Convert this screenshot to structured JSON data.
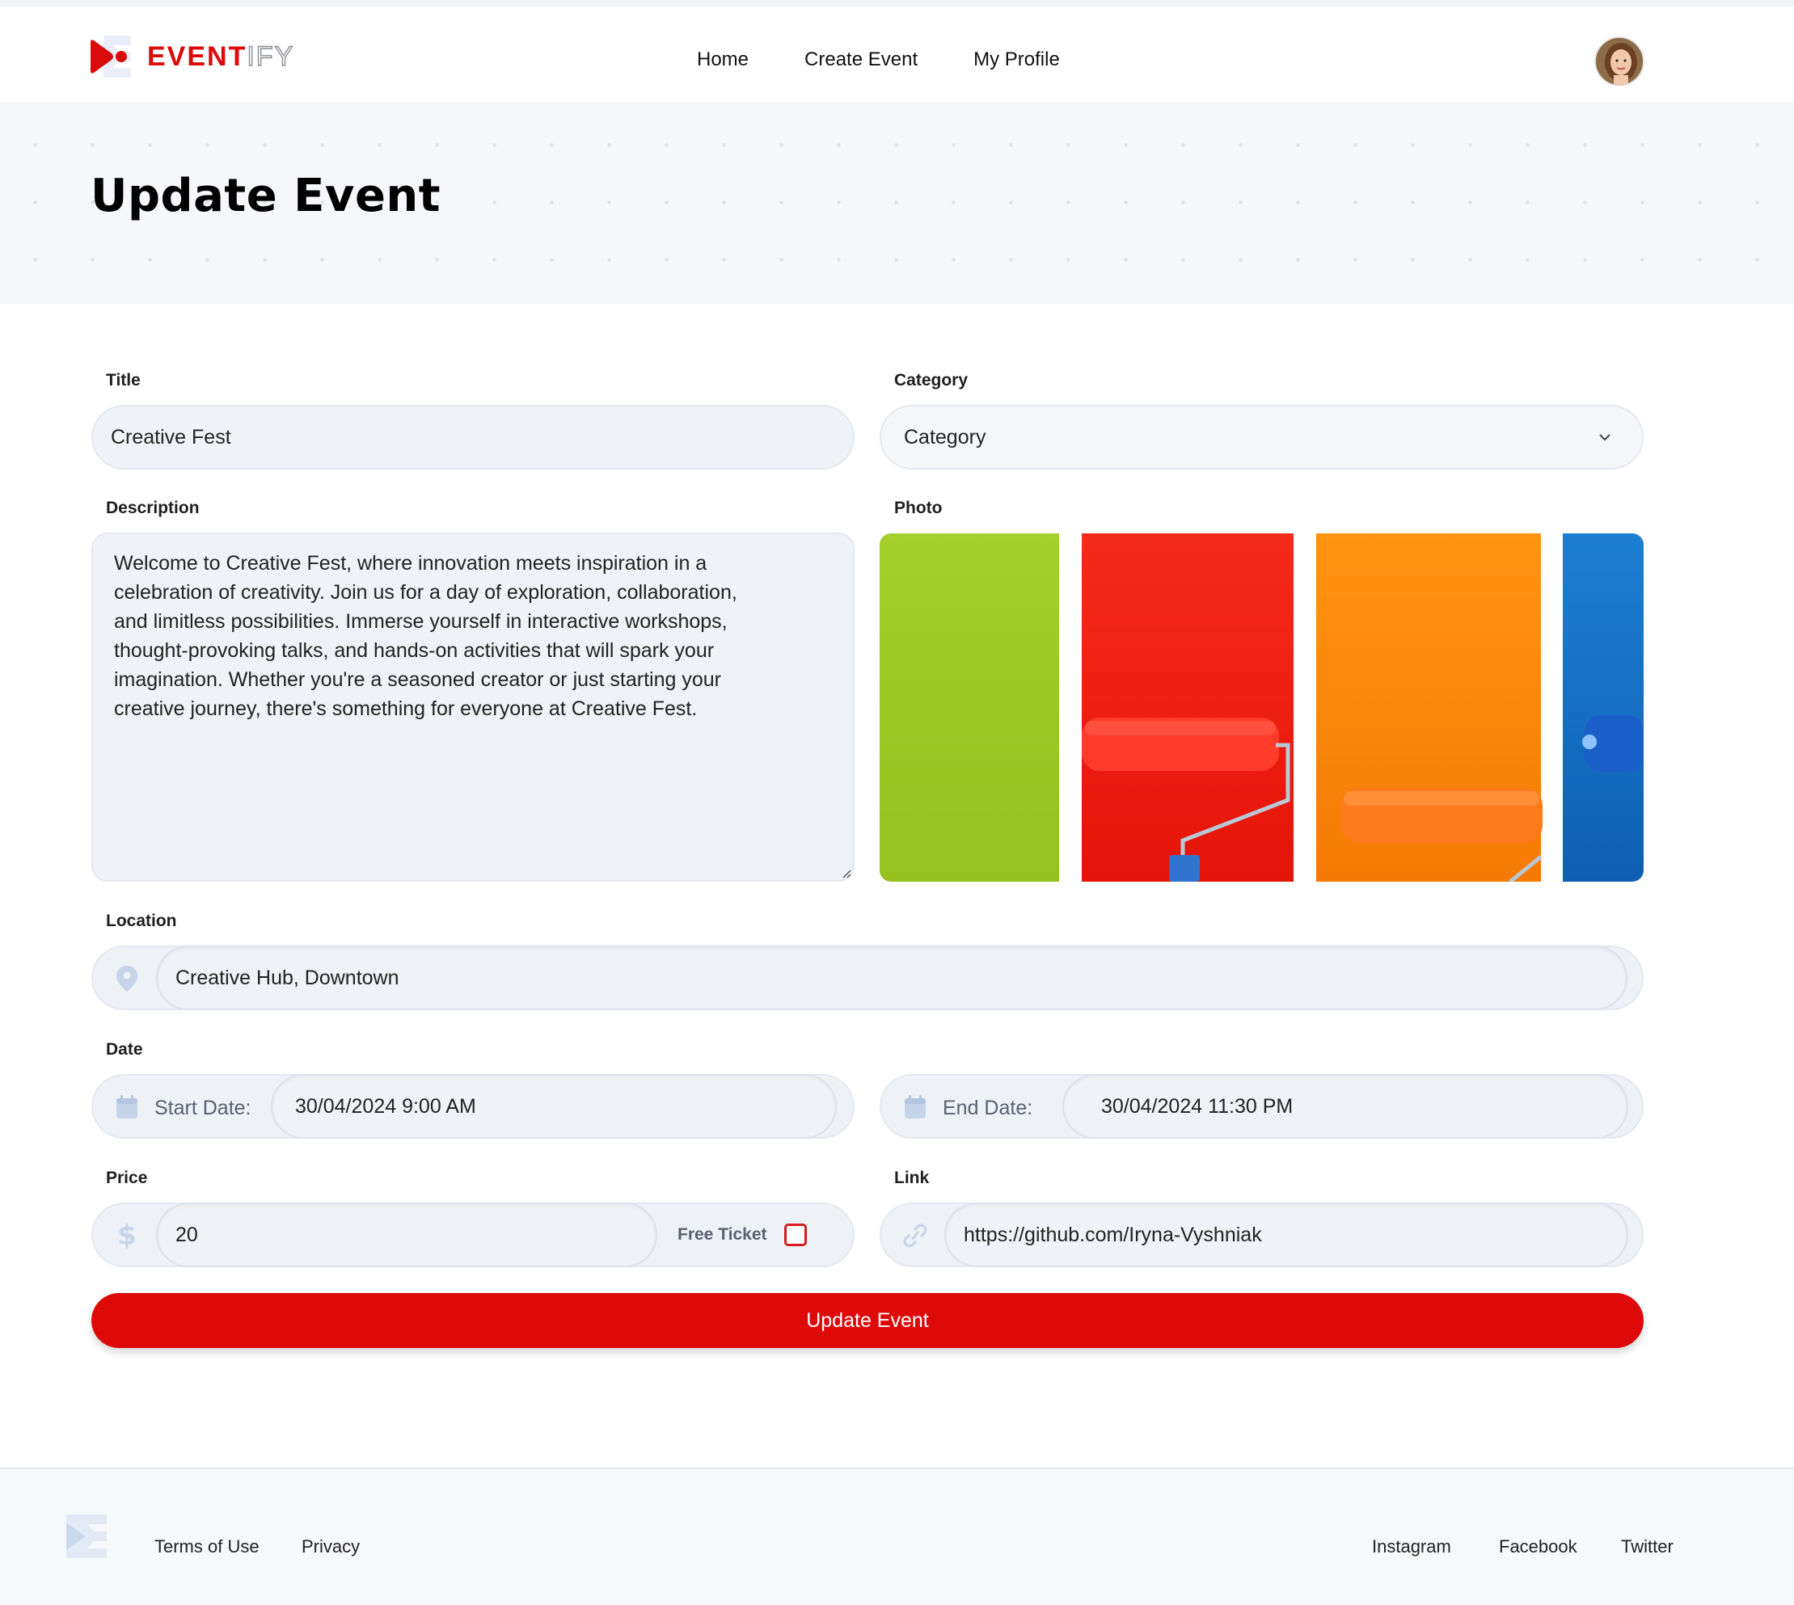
{
  "brand": {
    "name_part1": "EVENT",
    "name_part2": "IFY",
    "accent_color": "#d90b0b"
  },
  "nav": {
    "items": [
      "Home",
      "Create Event",
      "My Profile"
    ]
  },
  "page": {
    "title": "Update Event"
  },
  "form": {
    "title": {
      "label": "Title",
      "value": "Creative Fest"
    },
    "category": {
      "label": "Category",
      "selected": "Category"
    },
    "description": {
      "label": "Description",
      "lines": [
        "Welcome to Creative Fest, where innovation meets inspiration in a",
        "celebration of creativity. Join us for a day of exploration, collaboration,",
        "and limitless possibilities. Immerse yourself in interactive workshops,",
        "thought-provoking talks, and hands-on activities that will spark your",
        "imagination. Whether you're a seasoned creator or just starting your",
        "creative journey, there's something for everyone at Creative Fest."
      ]
    },
    "photo": {
      "label": "Photo"
    },
    "location": {
      "label": "Location",
      "value": "Creative Hub, Downtown",
      "icon": "location-pin-icon"
    },
    "date": {
      "label": "Date",
      "start_label": "Start Date:",
      "start_value": "30/04/2024 9:00 AM",
      "end_label": "End Date:",
      "end_value": "30/04/2024 11:30 PM",
      "icon": "calendar-icon"
    },
    "price": {
      "label": "Price",
      "value": "20",
      "free_ticket_label": "Free Ticket",
      "free_ticket_checked": false,
      "icon": "dollar-icon"
    },
    "link": {
      "label": "Link",
      "value": "https://github.com/Iryna-Vyshniak",
      "icon": "link-icon"
    },
    "submit_label": "Update Event"
  },
  "footer": {
    "left_links": [
      "Terms of Use",
      "Privacy"
    ],
    "right_links": [
      "Instagram",
      "Facebook",
      "Twitter"
    ]
  }
}
